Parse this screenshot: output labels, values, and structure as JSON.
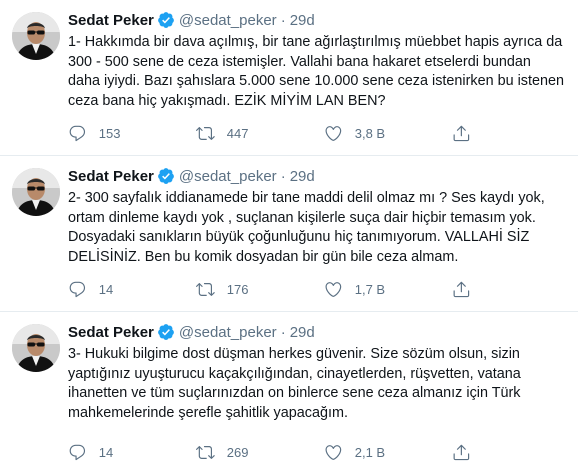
{
  "tweets": [
    {
      "name": "Sedat Peker",
      "handle": "@sedat_peker",
      "separator": "·",
      "time": "29d",
      "text": "1- Hakkımda bir dava açılmış, bir tane ağırlaştırılmış müebbet hapis ayrıca da 300 - 500 sene de ceza istemişler. Vallahi bana hakaret etselerdi bundan daha iyiydi. Bazı şahıslara 5.000 sene 10.000 sene ceza istenirken bu istenen ceza bana hiç yakışmadı. EZİK MİYİM LAN BEN?",
      "replies": "153",
      "retweets": "447",
      "likes": "3,8 B"
    },
    {
      "name": "Sedat Peker",
      "handle": "@sedat_peker",
      "separator": "·",
      "time": "29d",
      "text": "2- 300 sayfalık iddianamede bir tane maddi delil olmaz mı ? Ses kaydı yok, ortam dinleme kaydı yok , suçlanan kişilerle suça dair hiçbir temasım yok. Dosyadaki sanıkların büyük çoğunluğunu hiç tanımıyorum. VALLAHİ SİZ DELİSİNİZ. Ben bu komik dosyadan bir gün bile ceza almam.",
      "replies": "14",
      "retweets": "176",
      "likes": "1,7 B"
    },
    {
      "name": "Sedat Peker",
      "handle": "@sedat_peker",
      "separator": "·",
      "time": "29d",
      "text": "3- Hukuki bilgime dost düşman herkes güvenir. Size sözüm olsun, sizin yaptığınız uyuşturucu kaçakçılığından, cinayetlerden, rüşvetten, vatana ihanetten ve tüm suçlarınızdan on binlerce sene ceza almanız için Türk mahkemelerinde şerefle şahitlik yapacağım.",
      "replies": "14",
      "retweets": "269",
      "likes": "2,1 B"
    }
  ],
  "icons": {
    "verified": "verified-badge-icon",
    "reply": "reply-icon",
    "retweet": "retweet-icon",
    "like": "heart-icon",
    "share": "share-icon"
  },
  "colors": {
    "verified": "#1da1f2",
    "muted": "#5b7083",
    "text": "#0f1419",
    "divider": "#e6ecf0"
  }
}
